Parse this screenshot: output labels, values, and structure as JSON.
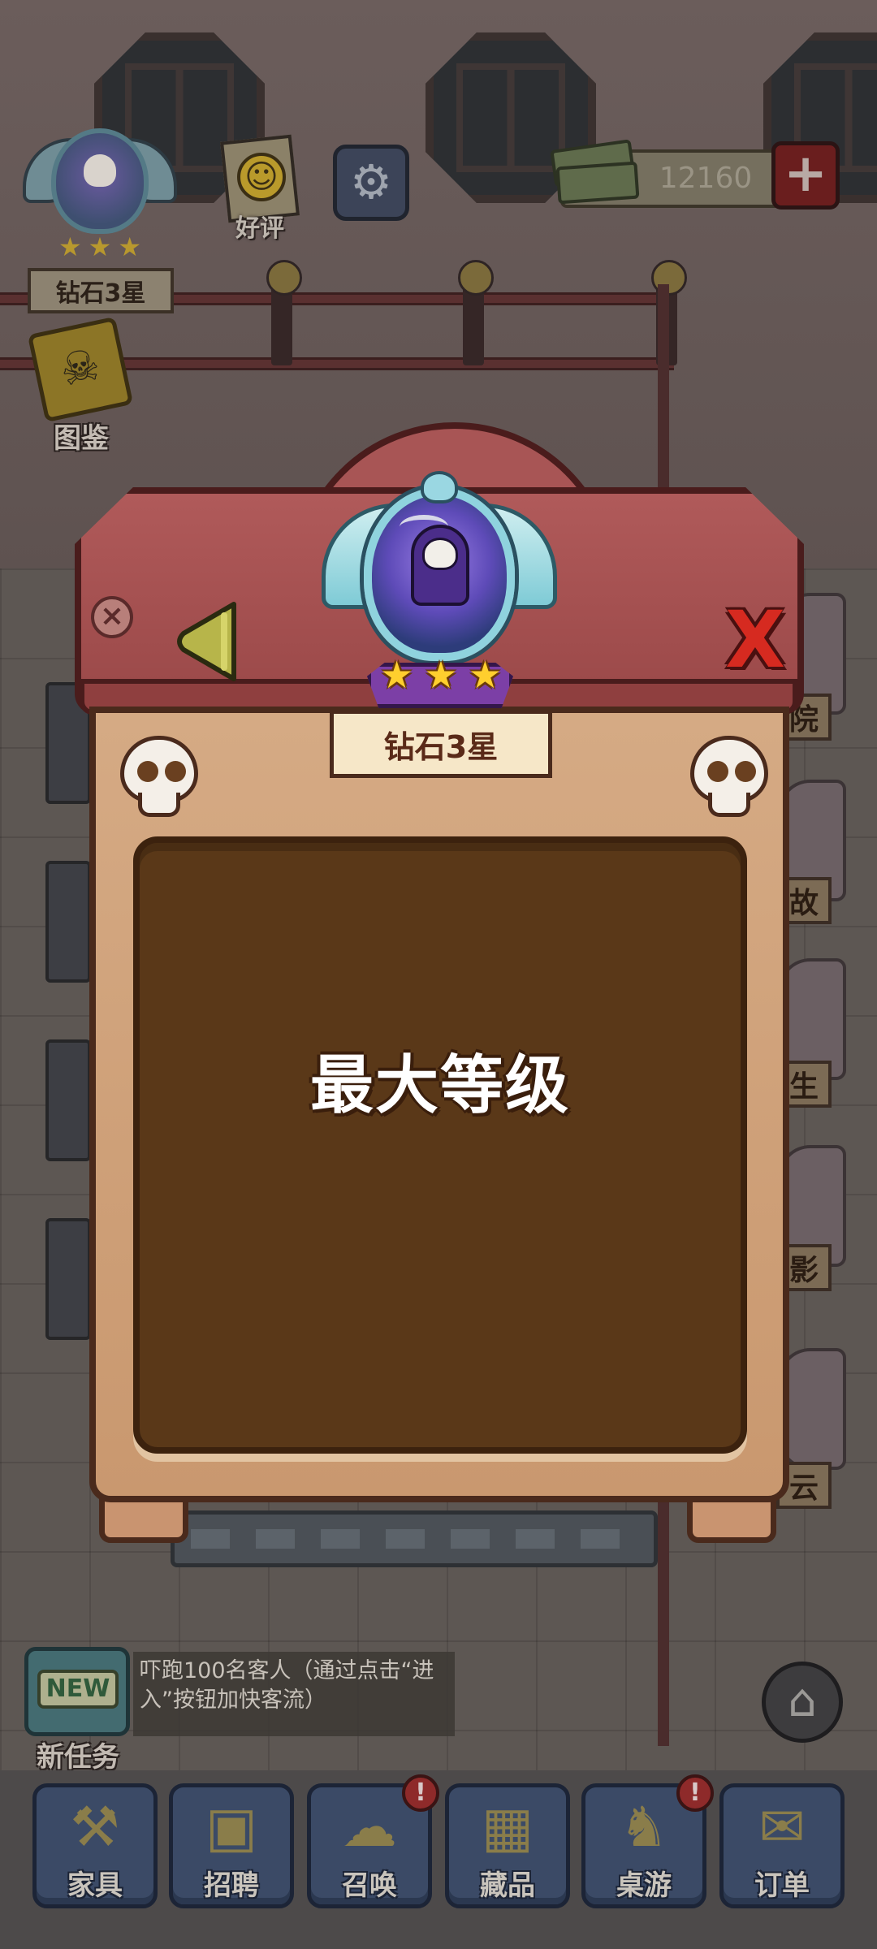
{
  "hud": {
    "player_rank": "钻石3星",
    "rank_stars": [
      "★",
      "★",
      "★"
    ],
    "review_label": "好评",
    "settings_glyph": "⚙",
    "cash_amount": "12160",
    "add_cash_glyph": "+",
    "handbook_label": "图鉴",
    "handbook_glyph": "☠"
  },
  "modal": {
    "rank_title": "钻石3星",
    "stars": [
      "★",
      "★",
      "★"
    ],
    "info_glyph": "×",
    "close_glyph": "X",
    "status_text": "最大等级"
  },
  "task": {
    "badge": "NEW",
    "label": "新任务",
    "description": "吓跑100名客人（通过点击“进入”按钮加快客流）"
  },
  "home_glyph": "⌂",
  "bottom_nav": [
    {
      "label": "家具",
      "icon": "tools-icon",
      "glyph": "⚒",
      "alert": ""
    },
    {
      "label": "招聘",
      "icon": "recruit-clipboard-icon",
      "glyph": "▣",
      "alert": ""
    },
    {
      "label": "召唤",
      "icon": "ghost-icon",
      "glyph": "☁",
      "alert": "!"
    },
    {
      "label": "藏品",
      "icon": "safe-icon",
      "glyph": "▦",
      "alert": ""
    },
    {
      "label": "桌游",
      "icon": "chessboard-icon",
      "glyph": "♞",
      "alert": "!"
    },
    {
      "label": "订单",
      "icon": "bat-box-icon",
      "glyph": "✉",
      "alert": ""
    }
  ],
  "side_tags": [
    "院",
    "故",
    "生",
    "影",
    "云"
  ],
  "colors": {
    "modal_header": "#b05a5a",
    "board_wood": "#d5aa84",
    "board_inner": "#5a3818",
    "close_red": "#d62a20",
    "star_gold": "#ffcf2e"
  }
}
